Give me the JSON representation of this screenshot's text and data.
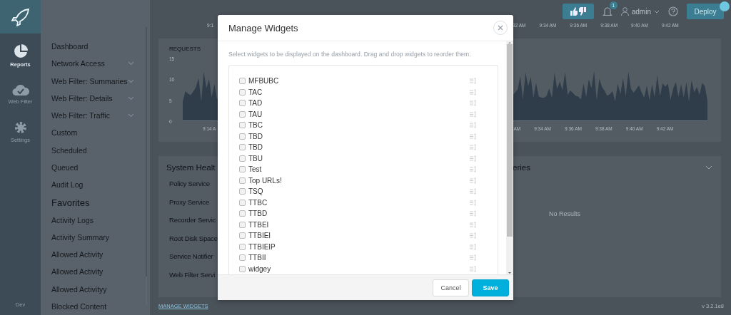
{
  "rail": {
    "items": [
      {
        "label": "Reports",
        "selected": true
      },
      {
        "label": "Web Filter",
        "selected": false
      },
      {
        "label": "Settings",
        "selected": false
      }
    ],
    "env": "Dev"
  },
  "subnav": {
    "items": [
      {
        "label": "Dashboard",
        "expandable": false
      },
      {
        "label": "Network Access",
        "expandable": true
      },
      {
        "label": "Web Filter: Summaries",
        "expandable": true
      },
      {
        "label": "Web Filter: Details",
        "expandable": true
      },
      {
        "label": "Web Filter: Traffic",
        "expandable": true
      },
      {
        "label": "Custom",
        "expandable": false
      },
      {
        "label": "Scheduled",
        "expandable": false
      },
      {
        "label": "Queued",
        "expandable": false
      },
      {
        "label": "Audit Log",
        "expandable": false
      }
    ],
    "favorites_title": "Favorites",
    "favorites": [
      "Activity Logs",
      "Activity Summary",
      "Allowed Activity",
      "Allowed Activity",
      "Allowed Activityy",
      "Blocked Content"
    ]
  },
  "topbar": {
    "notifications_badge": "1",
    "user": "admin",
    "deploy": "Deploy"
  },
  "top_axis": {
    "left": "9:1",
    "right": [
      "32 AM",
      "9:34 AM",
      "9:36 AM",
      "9:38 AM",
      "9:40 AM",
      "9:42 AM"
    ]
  },
  "requests": {
    "title": "REQUESTS",
    "y_ticks": [
      "15",
      "10",
      "5",
      "0"
    ],
    "x_left": "9:14 A",
    "x_right": [
      "AM",
      "9:34 AM",
      "9:36 AM",
      "9:38 AM",
      "9:40 AM",
      "9:42 AM"
    ]
  },
  "health": {
    "title": "System Healt",
    "items": [
      "Policy Service",
      "Proxy Service",
      "Recorder Servic",
      "Root Disk Space",
      "Service Notifier",
      "Web Filter Servi"
    ]
  },
  "queries": {
    "title": "eries",
    "empty": "No Results"
  },
  "footer": {
    "link": "MANAGE WIDGETS",
    "version": "v 3.2.1e8"
  },
  "modal": {
    "title": "Manage Widgets",
    "description": "Select widgets to be displayed on the dashboard. Drag and drop widgets to reorder them.",
    "widgets": [
      {
        "label": "MFBUBC",
        "checked": false
      },
      {
        "label": "TAC",
        "checked": false
      },
      {
        "label": "TAD",
        "checked": false
      },
      {
        "label": "TAU",
        "checked": false
      },
      {
        "label": "TBC",
        "checked": false
      },
      {
        "label": "TBD",
        "checked": false
      },
      {
        "label": "TBD",
        "checked": false
      },
      {
        "label": "TBU",
        "checked": false
      },
      {
        "label": "Test",
        "checked": false
      },
      {
        "label": "Top URLs!",
        "checked": false
      },
      {
        "label": "TSQ",
        "checked": false
      },
      {
        "label": "TTBC",
        "checked": false
      },
      {
        "label": "TTBD",
        "checked": false
      },
      {
        "label": "TTBEI",
        "checked": false
      },
      {
        "label": "TTBIEI",
        "checked": false
      },
      {
        "label": "TTBIEIP",
        "checked": false
      },
      {
        "label": "TTBII",
        "checked": false
      },
      {
        "label": "widgey",
        "checked": false
      }
    ],
    "buttons": [
      {
        "label": "Cancel",
        "kind": "secondary"
      },
      {
        "label": "Save",
        "kind": "primary"
      }
    ]
  }
}
